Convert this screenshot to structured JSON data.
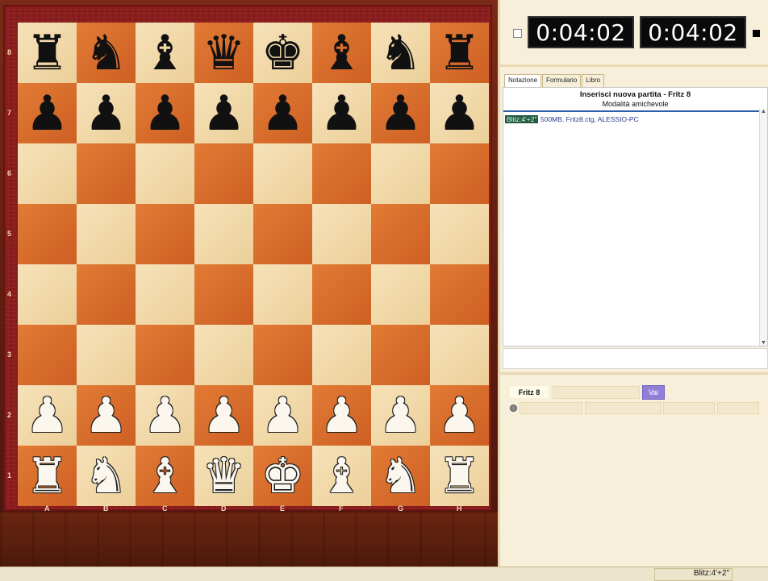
{
  "board": {
    "ranks": [
      "8",
      "7",
      "6",
      "5",
      "4",
      "3",
      "2",
      "1"
    ],
    "files": [
      "A",
      "B",
      "C",
      "D",
      "E",
      "F",
      "G",
      "H"
    ],
    "squares": [
      [
        "r",
        "n",
        "b",
        "q",
        "k",
        "b",
        "n",
        "r"
      ],
      [
        "p",
        "p",
        "p",
        "p",
        "p",
        "p",
        "p",
        "p"
      ],
      [
        "",
        "",
        "",
        "",
        "",
        "",
        "",
        ""
      ],
      [
        "",
        "",
        "",
        "",
        "",
        "",
        "",
        ""
      ],
      [
        "",
        "",
        "",
        "",
        "",
        "",
        "",
        ""
      ],
      [
        "",
        "",
        "",
        "",
        "",
        "",
        "",
        ""
      ],
      [
        "P",
        "P",
        "P",
        "P",
        "P",
        "P",
        "P",
        "P"
      ],
      [
        "R",
        "N",
        "B",
        "Q",
        "K",
        "B",
        "N",
        "R"
      ]
    ],
    "light_color": "#f1d8a6",
    "dark_color": "#d9692a",
    "frame_color": "#8b1d1d"
  },
  "clocks": {
    "white_time": "0:04:02",
    "black_time": "0:04:02"
  },
  "tabs": [
    {
      "label": "Notazione",
      "active": true
    },
    {
      "label": "Formulario",
      "active": false
    },
    {
      "label": "Libro",
      "active": false
    }
  ],
  "notation": {
    "title": "Inserisci nuova partita - Fritz 8",
    "subtitle": "Modalità amichevole",
    "time_control": "Blitz:4'+2\"",
    "game_info": "500MB, Fritz8.ctg, ALESSIO-PC"
  },
  "engine": {
    "name": "Fritz 8",
    "go_label": "Vai"
  },
  "status_bar": {
    "text": "Blitz:4'+2\""
  }
}
